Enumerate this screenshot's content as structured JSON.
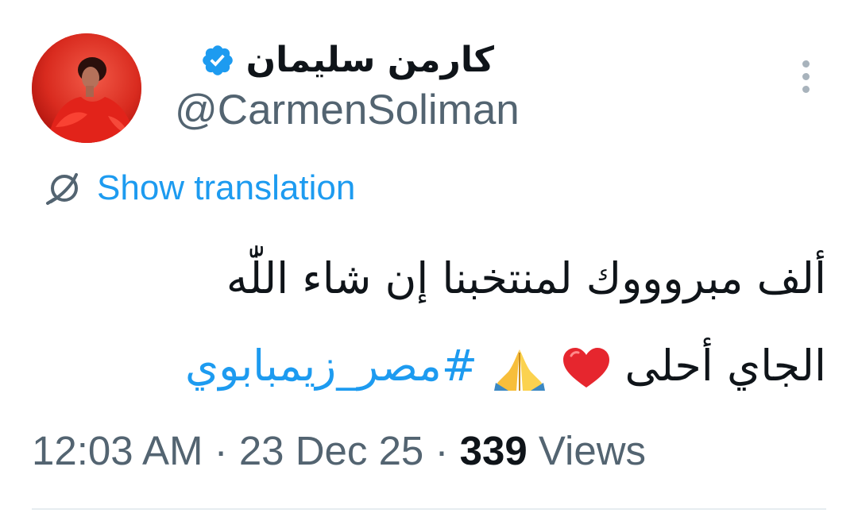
{
  "author": {
    "display_name": "كارمن سليمان",
    "handle": "@CarmenSoliman",
    "verified_icon": "verified-badge-icon",
    "avatar_icon": "profile-photo"
  },
  "more_menu_icon": "more-options-icon",
  "translate": {
    "label": "Show translation",
    "icon": "translate-globe-icon"
  },
  "tweet": {
    "line1": "ألف مبروووك لمنتخبنا إن شاء اللّٰه",
    "line2_text": "الجاي أحلى",
    "line2_emojis": [
      "red-heart-emoji",
      "folded-hands-emoji"
    ],
    "hashtag": "#مصر_زيمبابوي"
  },
  "meta": {
    "time": "12:03 AM",
    "separator": "·",
    "date": "23 Dec 25",
    "views_count": "339",
    "views_label": "Views"
  },
  "colors": {
    "link": "#1d9bf0",
    "secondary_text": "#536471",
    "primary_text": "#0f1419",
    "verified": "#1d9bf0",
    "avatar_bg": "#d9261c"
  }
}
